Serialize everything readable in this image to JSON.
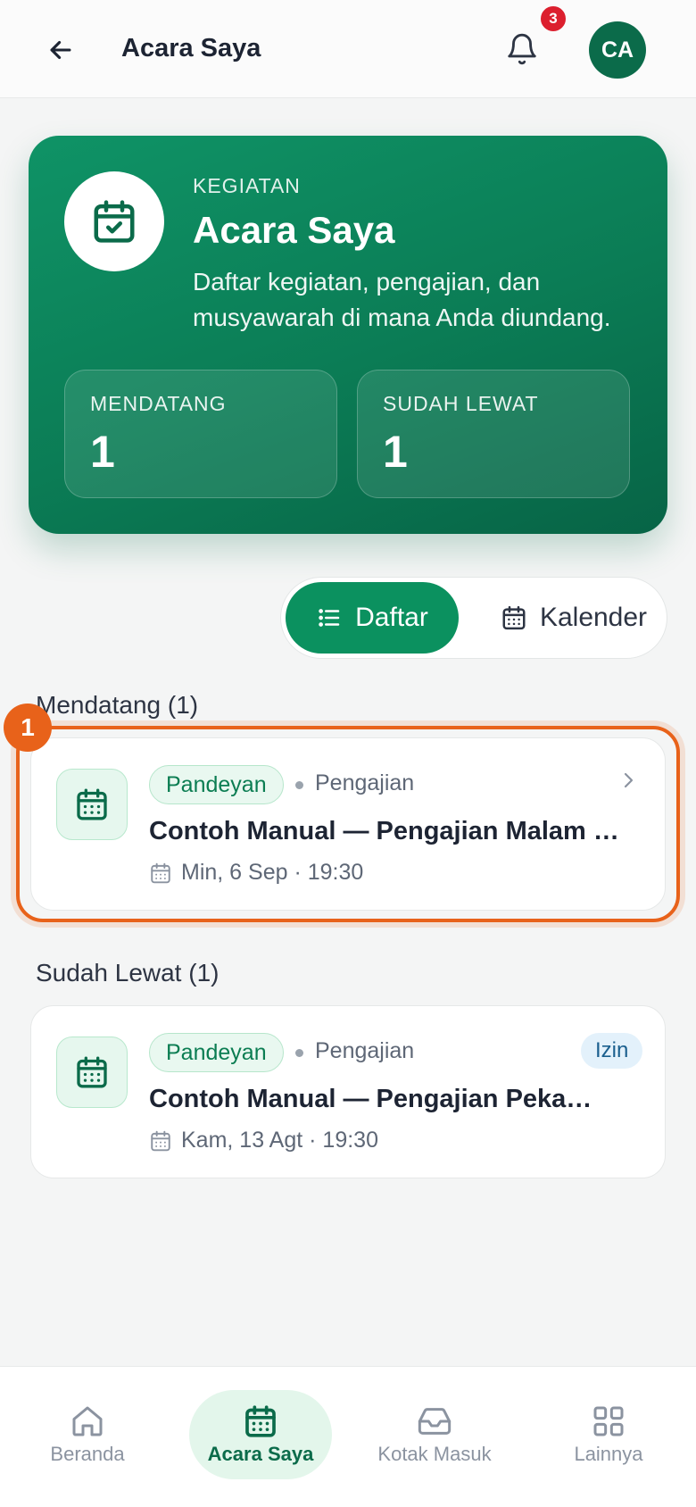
{
  "header": {
    "title": "Acara Saya",
    "notification_count": "3",
    "avatar_initials": "CA"
  },
  "hero": {
    "eyebrow": "KEGIATAN",
    "title": "Acara Saya",
    "description": "Daftar kegiatan, pengajian, dan musyawarah di mana Anda diundang.",
    "stats": [
      {
        "label": "MENDATANG",
        "value": "1"
      },
      {
        "label": "SUDAH LEWAT",
        "value": "1"
      }
    ]
  },
  "view_toggle": {
    "options": [
      {
        "label": "Daftar",
        "icon": "list-icon",
        "selected": true
      },
      {
        "label": "Kalender",
        "icon": "calendar-icon",
        "selected": false
      }
    ]
  },
  "sections": {
    "upcoming": {
      "title": "Mendatang (1)",
      "events": [
        {
          "group": "Pandeyan",
          "type": "Pengajian",
          "title": "Contoh Manual — Pengajian Malam …",
          "datetime": "Min, 6 Sep · 19:30"
        }
      ]
    },
    "past": {
      "title": "Sudah Lewat (1)",
      "events": [
        {
          "group": "Pandeyan",
          "type": "Pengajian",
          "title": "Contoh Manual — Pengajian Peka…",
          "datetime": "Kam, 13 Agt · 19:30",
          "status": "Izin"
        }
      ]
    }
  },
  "annotation": {
    "number": "1"
  },
  "bottom_nav": {
    "items": [
      {
        "label": "Beranda",
        "icon": "home-icon",
        "active": false
      },
      {
        "label": "Acara Saya",
        "icon": "calendar-icon",
        "active": true
      },
      {
        "label": "Kotak Masuk",
        "icon": "inbox-icon",
        "active": false
      },
      {
        "label": "Lainnya",
        "icon": "grid-icon",
        "active": false
      }
    ]
  },
  "colors": {
    "brand": "#0b6b4a",
    "brand_button": "#0b915f",
    "highlight": "#e8621a",
    "badge": "#dc1f2e"
  }
}
